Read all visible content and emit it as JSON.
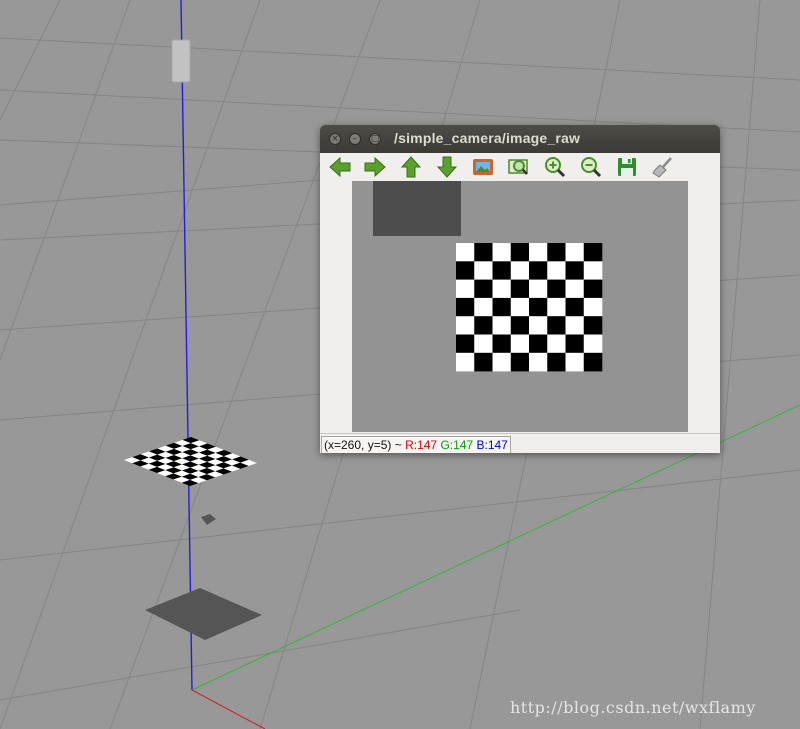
{
  "window": {
    "title": "/simple_camera/image_raw",
    "close_glyph": "×",
    "minimize_glyph": "–",
    "maximize_glyph": "□"
  },
  "toolbar": {
    "buttons": [
      {
        "icon": "arrow-left-icon",
        "color": "#5aa02c"
      },
      {
        "icon": "arrow-right-icon",
        "color": "#5aa02c"
      },
      {
        "icon": "arrow-up-icon",
        "color": "#5aa02c"
      },
      {
        "icon": "arrow-down-icon",
        "color": "#5aa02c"
      },
      {
        "icon": "image-fit-icon",
        "color": "#c8662e"
      },
      {
        "icon": "zoom-fit-icon",
        "color": "#4e8c2a"
      },
      {
        "icon": "zoom-in-icon",
        "color": "#4e8c2a"
      },
      {
        "icon": "zoom-out-icon",
        "color": "#4e8c2a"
      },
      {
        "icon": "save-icon",
        "color": "#2f8f2f"
      },
      {
        "icon": "clear-brush-icon",
        "color": "#8a8a8a"
      }
    ]
  },
  "status": {
    "coords": "(x=260, y=5) ~",
    "r": "R:147",
    "g": "G:147",
    "b": "B:147",
    "r_color": "#e00000",
    "g_color": "#00a000",
    "b_color": "#0000e0"
  },
  "watermark": "http://blog.csdn.net/wxflamy"
}
